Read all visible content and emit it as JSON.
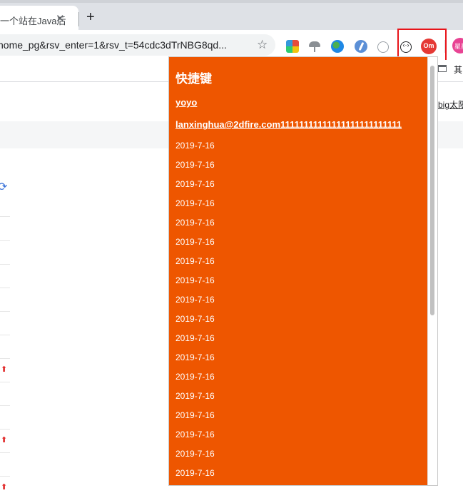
{
  "browser": {
    "tab": {
      "title": "一个站在Java后",
      "close_glyph": "✕"
    },
    "new_tab_glyph": "+",
    "address_bar": {
      "url": "home_pg&rsv_enter=1&rsv_t=54cdc3dTrNBG8qd...",
      "star_glyph": "☆"
    },
    "extensions": [
      {
        "name": "colorful-square-icon"
      },
      {
        "name": "mushroom-icon"
      },
      {
        "name": "globe-icon"
      },
      {
        "name": "pen-icon"
      },
      {
        "name": "speed-icon"
      },
      {
        "name": "code-brackets-icon",
        "glyph": "‹·›"
      },
      {
        "name": "om-extension-icon",
        "text": "Om",
        "highlighted": true
      }
    ],
    "profile": {
      "text": "星星"
    },
    "bookmarks": {
      "folder_label": "其"
    },
    "highlight_color": "#e8141a"
  },
  "background_page": {
    "link_text": "big太阳",
    "refresh_glyph": "⟳",
    "arrow_glyph": "⬆"
  },
  "popup": {
    "title": "快捷键",
    "username": "yoyo",
    "email": "lanxinghua@2dfire.com11111111111111111111111111",
    "dates": [
      "2019-7-16",
      "2019-7-16",
      "2019-7-16",
      "2019-7-16",
      "2019-7-16",
      "2019-7-16",
      "2019-7-16",
      "2019-7-16",
      "2019-7-16",
      "2019-7-16",
      "2019-7-16",
      "2019-7-16",
      "2019-7-16",
      "2019-7-16",
      "2019-7-16",
      "2019-7-16",
      "2019-7-16",
      "2019-7-16"
    ],
    "background_color": "#ee5600"
  }
}
